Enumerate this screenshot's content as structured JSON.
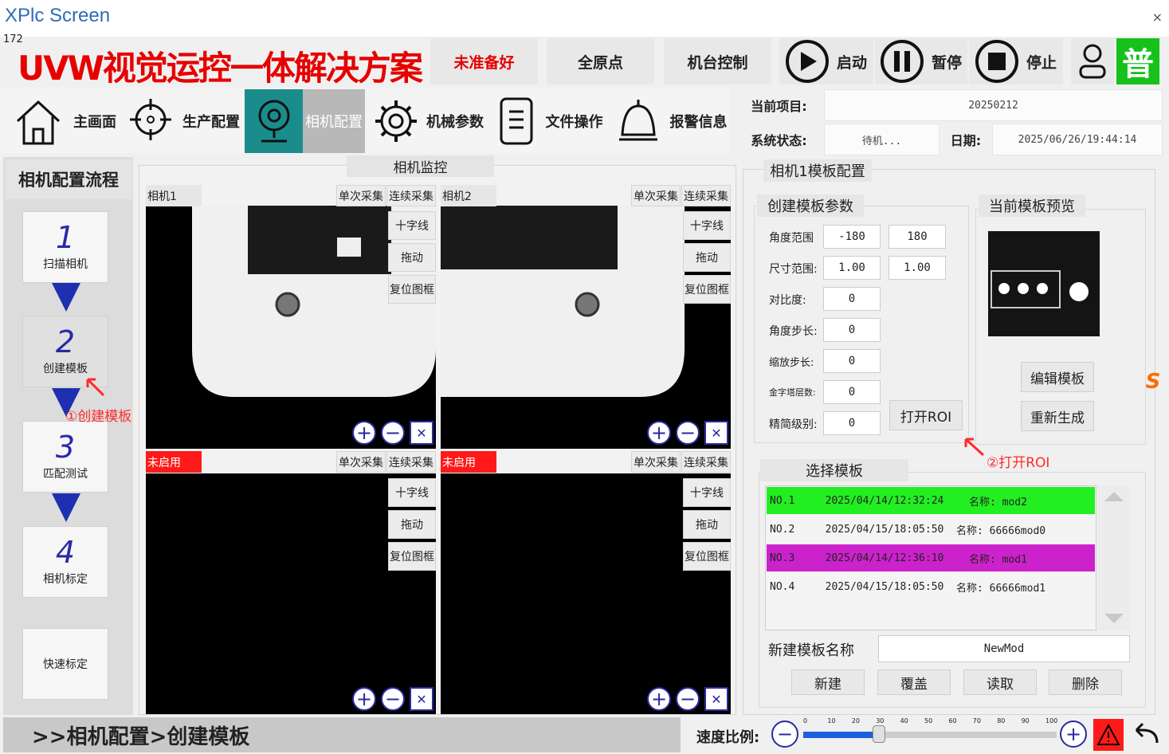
{
  "window": {
    "title": "XPlc Screen",
    "close": "×",
    "counter": "172"
  },
  "banner": "UVW视觉运控一体解决方案",
  "toolbar": {
    "status": "未准备好",
    "home": "全原点",
    "machine": "机台控制",
    "start": "启动",
    "pause": "暂停",
    "stop": "停止",
    "user_level": "普"
  },
  "nav": [
    {
      "label": "主画面",
      "icon": "home-icon"
    },
    {
      "label": "生产配置",
      "icon": "crosshair-icon"
    },
    {
      "label": "相机配置",
      "icon": "camera-icon"
    },
    {
      "label": "机械参数",
      "icon": "gear-icon"
    },
    {
      "label": "文件操作",
      "icon": "file-icon"
    },
    {
      "label": "报警信息",
      "icon": "bell-icon"
    }
  ],
  "info": {
    "project_label": "当前项目:",
    "project": "20250212",
    "state_label": "系统状态:",
    "state": "待机...",
    "date_label": "日期:",
    "date": "2025/06/26/19:44:14"
  },
  "flow": {
    "title": "相机配置流程",
    "steps": [
      {
        "num": "1",
        "label": "扫描相机"
      },
      {
        "num": "2",
        "label": "创建模板"
      },
      {
        "num": "3",
        "label": "匹配测试"
      },
      {
        "num": "4",
        "label": "相机标定"
      }
    ],
    "quick": "快速标定"
  },
  "monitor": {
    "title": "相机监控",
    "cams": [
      {
        "name": "相机1"
      },
      {
        "name": "相机2"
      },
      {
        "name": "未启用"
      },
      {
        "name": "未启用"
      }
    ],
    "single": "单次采集",
    "continuous": "连续采集",
    "crosshair": "十字线",
    "drag": "拖动",
    "reset": "复位图框"
  },
  "template": {
    "title": "相机1模板配置",
    "params_title": "创建模板参数",
    "angle_label": "角度范围",
    "angle_min": "-180",
    "angle_max": "180",
    "scale_label": "尺寸范围:",
    "scale_min": "1.00",
    "scale_max": "1.00",
    "contrast_label": "对比度:",
    "contrast": "0",
    "angle_step_label": "角度步长:",
    "angle_step": "0",
    "scale_step_label": "缩放步长:",
    "scale_step": "0",
    "pyramid_label": "金字塔层数:",
    "pyramid": "0",
    "precision_label": "精简级别:",
    "precision": "0",
    "open_roi": "打开ROI",
    "preview_title": "当前模板预览",
    "edit": "编辑模板",
    "regen": "重新生成"
  },
  "select": {
    "title": "选择模板",
    "rows": [
      {
        "no": "NO.1",
        "date": "2025/04/14/12:32:24",
        "name": "名称: mod2",
        "color": "#22ee22"
      },
      {
        "no": "NO.2",
        "date": "2025/04/15/18:05:50",
        "name": "名称: 66666mod0",
        "color": "#f4f4f4"
      },
      {
        "no": "NO.3",
        "date": "2025/04/14/12:36:10",
        "name": "名称: mod1",
        "color": "#cc22cc"
      },
      {
        "no": "NO.4",
        "date": "2025/04/15/18:05:50",
        "name": "名称: 66666mod1",
        "color": "#f4f4f4"
      }
    ],
    "new_name_label": "新建模板名称",
    "new_name": "NewMod",
    "btn_new": "新建",
    "btn_overwrite": "覆盖",
    "btn_read": "读取",
    "btn_delete": "删除"
  },
  "annotations": {
    "a1": "①创建模板",
    "a2": "②打开ROI"
  },
  "footer": {
    "breadcrumb": ">>相机配置>创建模板",
    "speed_label": "速度比例:",
    "speed_ticks": [
      "0",
      "10",
      "20",
      "30",
      "40",
      "50",
      "60",
      "70",
      "80",
      "90",
      "100"
    ],
    "speed_value": 30
  }
}
